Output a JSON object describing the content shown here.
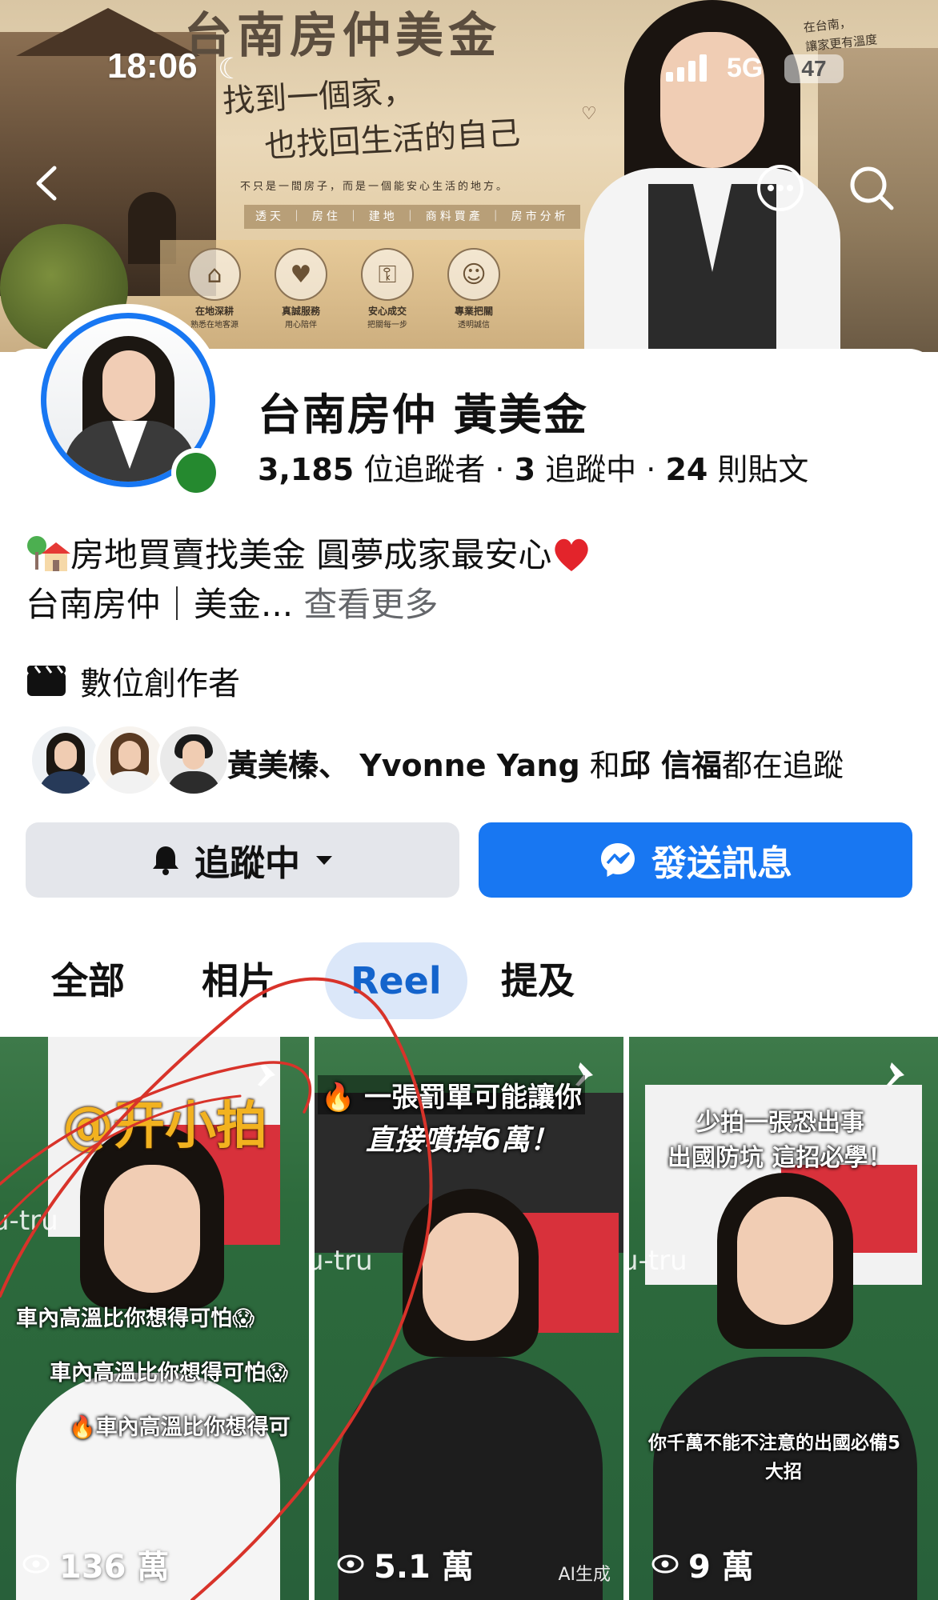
{
  "status_bar": {
    "time": "18:06",
    "network": "5G",
    "battery": "47"
  },
  "cover": {
    "title": "台南房仲美金",
    "slogan_line1": "找到一個家，",
    "slogan_line2": "也找回生活的自己",
    "subline": "不只是一間房子，而是一個能安心生活的地方。",
    "categories": "透天 ｜ 房住 ｜ 建地 ｜ 商料買產 ｜ 房市分析",
    "corner_note_line1": "在台南，",
    "corner_note_line2": "讓家更有溫度",
    "badges": [
      {
        "icon": "house-icon",
        "title": "在地深耕",
        "sub": "熟悉在地客源"
      },
      {
        "icon": "heart-icon",
        "title": "真誠服務",
        "sub": "用心陪伴"
      },
      {
        "icon": "key-icon",
        "title": "安心成交",
        "sub": "把關每一步"
      },
      {
        "icon": "people-icon",
        "title": "專業把關",
        "sub": "透明誠信"
      }
    ]
  },
  "profile": {
    "name": "台南房仲 黃美金",
    "followers_count": "3,185",
    "followers_label": "位追蹤者",
    "following_count": "3",
    "following_label": "追蹤中",
    "posts_count": "24",
    "posts_label": "則貼文",
    "separator": "·",
    "bio_line1": "房地買賣找美金 圓夢成家最安心",
    "bio_line2": "台南房仲｜美金...",
    "see_more": "查看更多",
    "category": "數位創作者",
    "mutual_names": "黃美榛、 Yvonne Yang",
    "mutual_and": "和",
    "mutual_last": "邱 信福",
    "mutual_suffix": "都在追蹤"
  },
  "actions": {
    "follow_label": "追蹤中",
    "message_label": "發送訊息"
  },
  "tabs": [
    {
      "label": "全部",
      "active": false
    },
    {
      "label": "相片",
      "active": false
    },
    {
      "label": "Reel",
      "active": true
    },
    {
      "label": "提及",
      "active": false
    }
  ],
  "reels": [
    {
      "top_caption": "@开小拍",
      "captions": [
        "車內高溫比你想得可怕😱",
        "車內高溫比你想得可怕😱",
        "🔥車內高溫比你想得可"
      ],
      "views": "136 萬",
      "pinned": true
    },
    {
      "top_caption_line1": "🔥 一張罰單可能讓你",
      "top_caption_line2": "直接噴掉6萬！",
      "views": "5.1 萬",
      "badge": "AI生成",
      "pinned": true
    },
    {
      "top_caption_line1": "少拍一張恐出事",
      "top_caption_line2": "出國防坑 這招必學！",
      "bottom_caption_line1": "你千萬不能不注意的出國必備5",
      "bottom_caption_line2": "大招",
      "views": "9 萬",
      "pinned": true
    }
  ],
  "colors": {
    "accent": "#1877f2",
    "online": "#25892f",
    "annotation": "#d8332a"
  }
}
